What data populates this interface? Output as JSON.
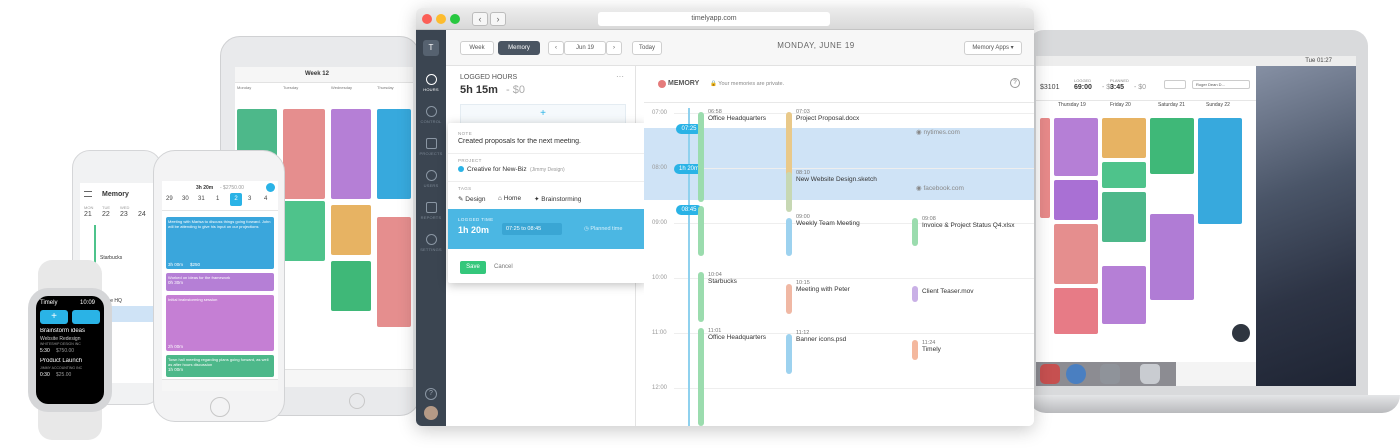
{
  "browser": {
    "url": "timelyapp.com"
  },
  "sidebar": {
    "logo": "T",
    "items": [
      {
        "label": "HOURS",
        "icon": "clock-icon"
      },
      {
        "label": "CONTROL",
        "icon": "chart-icon"
      },
      {
        "label": "PROJECTS",
        "icon": "briefcase-icon"
      },
      {
        "label": "USERS",
        "icon": "users-icon"
      },
      {
        "label": "REPORTS",
        "icon": "reports-icon"
      },
      {
        "label": "SETTINGS",
        "icon": "gear-icon"
      }
    ],
    "help": "?"
  },
  "toolbar": {
    "week": "Week",
    "memory": "Memory",
    "date_picker": "Jun 19",
    "today": "Today",
    "date_title": "MONDAY, JUNE 19",
    "memory_apps": "Memory Apps"
  },
  "logged": {
    "title": "LOGGED HOURS",
    "total": "5h 15m",
    "amount": "- $0",
    "add": "+"
  },
  "editor": {
    "note_label": "NOTE",
    "note": "Created proposals for the next meeting.",
    "project_label": "PROJECT",
    "project": "Creative for New-Biz",
    "project_client": "(Jimmy Design)",
    "tags_label": "TAGS",
    "tags": [
      "Design",
      "Home",
      "Brainstorming"
    ],
    "logged_label": "LOGGED TIME",
    "logged_time": "1h 20m",
    "from": "07:25",
    "to_sep": "to",
    "to": "08:45",
    "planned": "Planned time",
    "save": "Save",
    "cancel": "Cancel"
  },
  "memory": {
    "title": "MEMORY",
    "privacy": "Your memories are private.",
    "help": "?",
    "hours": [
      "07:00",
      "08:00",
      "09:00",
      "10:00",
      "11:00",
      "12:00"
    ],
    "pills": {
      "start": "07:25",
      "duration": "1h 20m",
      "end": "08:45"
    },
    "entries": [
      {
        "time": "06:58",
        "title": "Office Headquarters"
      },
      {
        "time": "07:03",
        "title": "Project Proposal.docx"
      },
      {
        "time": "08:10",
        "title": "New Website Design.sketch"
      },
      {
        "time": "09:00",
        "title": "Weekly Team Meeting"
      },
      {
        "time": "09:08",
        "title": "Invoice & Project Status Q4.xlsx"
      },
      {
        "time": "10:04",
        "title": "Starbucks"
      },
      {
        "time": "10:15",
        "title": "Meeting with Peter"
      },
      {
        "time": "",
        "title": "Client Teaser.mov"
      },
      {
        "time": "11:01",
        "title": "Office Headquarters"
      },
      {
        "time": "11:12",
        "title": "Banner icons.psd"
      },
      {
        "time": "11:24",
        "title": "Timely"
      }
    ],
    "sites": [
      "nytimes.com",
      "facebook.com"
    ]
  },
  "tablet": {
    "week": "Week 12",
    "days": [
      "Monday",
      "Tuesday",
      "Wednesday",
      "Thursday"
    ]
  },
  "phone_back": {
    "title": "Memory",
    "days": [
      "MON",
      "TUE",
      "WED"
    ],
    "nums": [
      "21",
      "22",
      "23",
      "24"
    ],
    "items": [
      "Starbucks",
      "Office HQ"
    ]
  },
  "phone_front": {
    "summary": "3h 20m",
    "amount": "- $2750.00",
    "days": [
      "29",
      "30",
      "31",
      "1",
      "2",
      "3",
      "4"
    ],
    "cards": [
      {
        "text": "Meeting with Marisa to discuss things going forward. John will be attending to give his input on our projections",
        "time": "3h 00m",
        "amt": "$250"
      },
      {
        "text": "Worked on ideas for the framework",
        "time": "0h 30m",
        "amt": "$250"
      },
      {
        "text": "Initial brainstorming session",
        "time": "2h 00m",
        "amt": "$250"
      },
      {
        "text": "Town hall meeting regarding plans going forward, as well as after hours discussion",
        "time": "1h 00m",
        "amt": "$250"
      }
    ]
  },
  "watch": {
    "app": "Timely",
    "clock": "10:09",
    "items": [
      {
        "title": "Brainstorm ideas",
        "sub": "Website Redesign",
        "client": "WHITESHIP DESIGN INC",
        "time": "5:30",
        "amt": "$750.00"
      },
      {
        "title": "Product Launch",
        "client": "JIMMY ACCOUNTING INC",
        "time": "0:30",
        "amt": "$25.00"
      }
    ]
  },
  "laptop": {
    "clock": "Tue 01:27",
    "logged_label": "LOGGED",
    "logged": "69:00",
    "logged_amt": "- $0",
    "planned_label": "PLANNED",
    "planned": "3:45",
    "planned_amt": "- $0",
    "amount_left": "$3101",
    "days": [
      "Thursday 19",
      "Friday 20",
      "Saturday 21",
      "Sunday 22"
    ],
    "user": "Roger Dean D..."
  },
  "colors": {
    "accent": "#2ab3e6",
    "sidebar": "#3b4551",
    "save": "#34c77b",
    "selection": "#cfe3f6"
  }
}
